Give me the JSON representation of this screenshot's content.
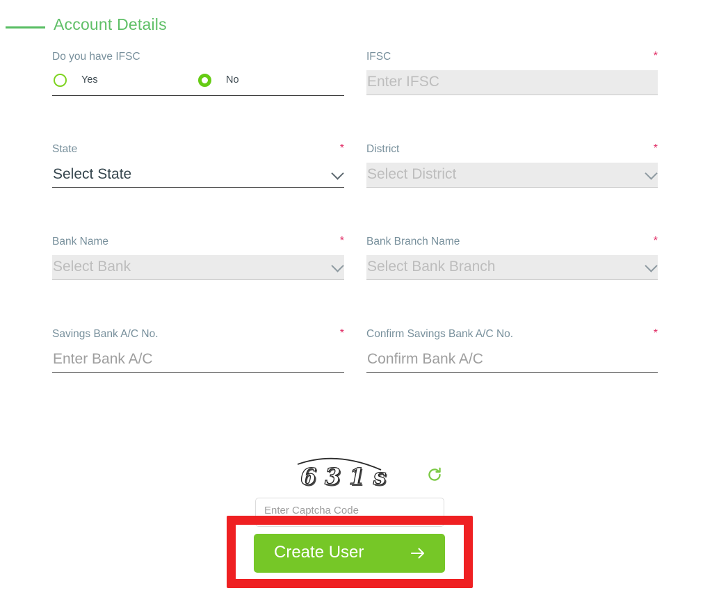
{
  "section": {
    "title": "Account Details",
    "accent_color": "#5fbf67",
    "dash_icon": "section-dash-icon"
  },
  "colors": {
    "heading_green": "#5fbf67",
    "button_green": "#76c727",
    "radio_green": "#66cc14",
    "required_star": "#e02862",
    "label_grey": "#78909c",
    "disabled_bg": "#ebebeb",
    "annotation_red": "#ef2022"
  },
  "fields": {
    "ifsc_question": {
      "label": "Do you have IFSC",
      "required": false,
      "options": [
        {
          "label": "Yes",
          "selected": false
        },
        {
          "label": "No",
          "selected": true
        }
      ]
    },
    "ifsc": {
      "label": "IFSC",
      "required": true,
      "placeholder": "Enter IFSC",
      "value": "",
      "disabled": true
    },
    "state": {
      "label": "State",
      "required": true,
      "value": "Select State",
      "disabled": false
    },
    "district": {
      "label": "District",
      "required": true,
      "value": "Select District",
      "disabled": true
    },
    "bank_name": {
      "label": "Bank Name",
      "required": true,
      "value": "Select Bank",
      "disabled": true
    },
    "bank_branch_name": {
      "label": "Bank Branch Name",
      "required": true,
      "value": "Select Bank Branch",
      "disabled": true
    },
    "savings_ac": {
      "label": "Savings Bank A/C No.",
      "required": true,
      "placeholder": "Enter Bank A/C",
      "value": "",
      "disabled": false
    },
    "confirm_savings_ac": {
      "label": "Confirm Savings Bank A/C No.",
      "required": true,
      "placeholder": "Confirm Bank A/C",
      "value": "",
      "disabled": false
    }
  },
  "captcha": {
    "code_text": "631s",
    "refresh_icon": "refresh-icon",
    "input_placeholder": "Enter Captcha Code",
    "input_value": ""
  },
  "submit": {
    "label": "Create User",
    "arrow_icon": "arrow-right-icon"
  },
  "required_marker": "*"
}
